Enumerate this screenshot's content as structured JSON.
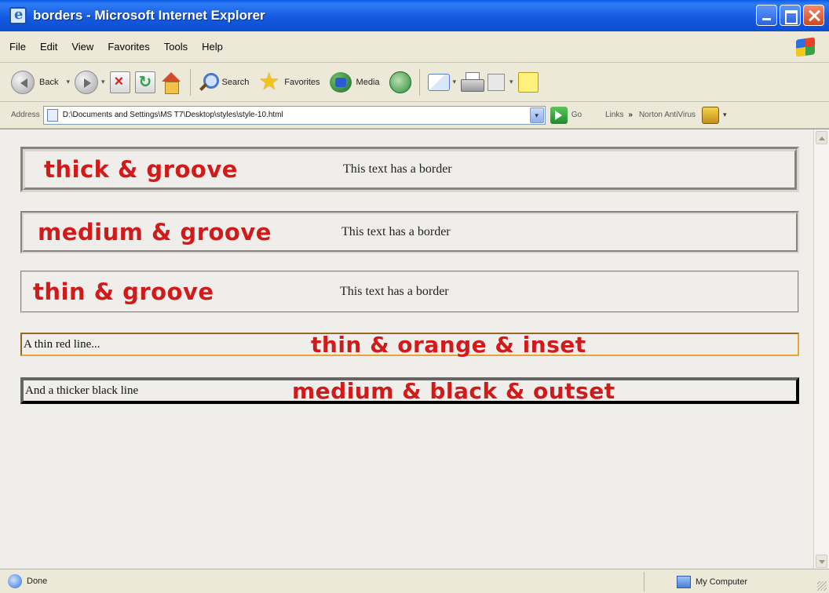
{
  "window": {
    "title": "borders - Microsoft Internet Explorer"
  },
  "menu": {
    "items": [
      "File",
      "Edit",
      "View",
      "Favorites",
      "Tools",
      "Help"
    ]
  },
  "toolbar": {
    "back_label": "Back",
    "search_label": "Search",
    "favorites_label": "Favorites",
    "media_label": "Media"
  },
  "address": {
    "label": "Address",
    "url": "D:\\Documents and Settings\\MS T7\\Desktop\\styles\\style-10.html",
    "go_label": "Go",
    "links_label": "Links",
    "chevron": "»",
    "norton_label": "Norton AntiVirus"
  },
  "content": {
    "boxes": [
      {
        "label": "thick & groove",
        "note": "This text has a border"
      },
      {
        "label": "medium & groove",
        "note": "This text has a border"
      },
      {
        "label": "thin & groove",
        "note": "This text has a border"
      }
    ],
    "lines": [
      {
        "text": "A thin red line...",
        "label": "thin & orange & inset"
      },
      {
        "text": "And a thicker black line",
        "label": "medium & black & outset"
      }
    ]
  },
  "status": {
    "left": "Done",
    "zone": "My Computer"
  },
  "colors": {
    "title_bar": "#0b4ed1",
    "label_red": "#d11a1a",
    "orange_border": "#e7a537",
    "black_border": "#111111"
  }
}
